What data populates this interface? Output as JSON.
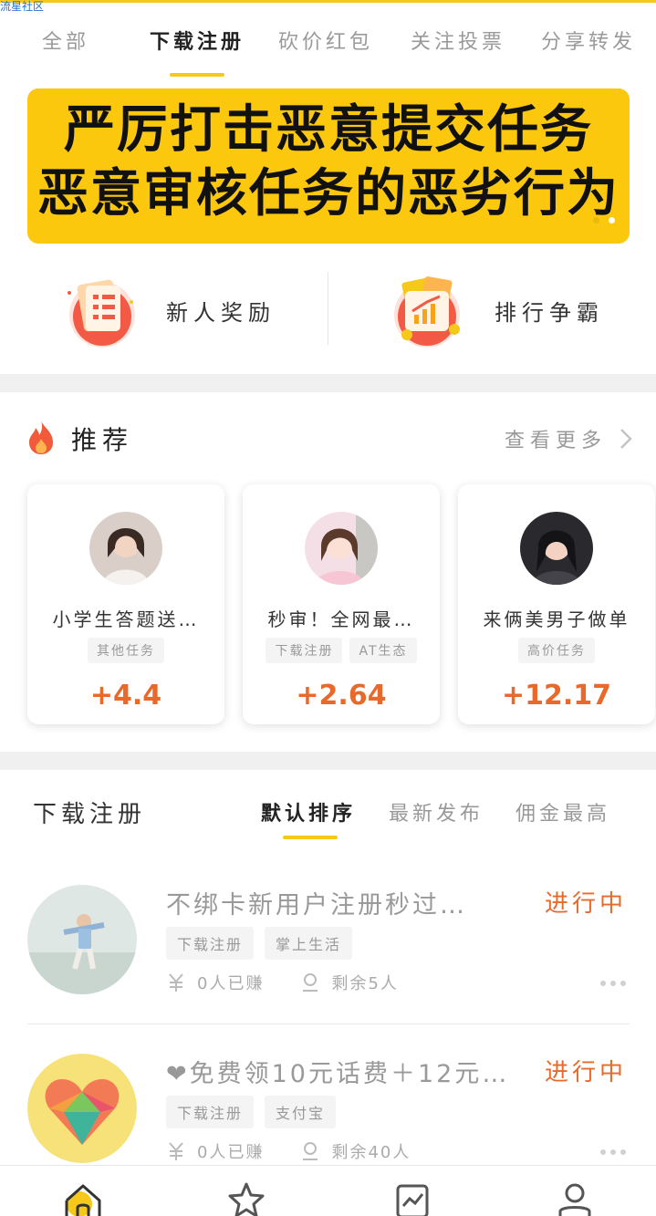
{
  "watermark": "流星社区",
  "tabs": [
    {
      "label": "全部",
      "active": false
    },
    {
      "label": "下载注册",
      "active": true
    },
    {
      "label": "砍价红包",
      "active": false
    },
    {
      "label": "关注投票",
      "active": false
    },
    {
      "label": "分享转发",
      "active": false
    }
  ],
  "banner": {
    "line1": "严厉打击恶意提交任务",
    "line2": "恶意审核任务的恶劣行为",
    "accent": "#fcc80d"
  },
  "quick_entries": [
    {
      "label": "新人奖励",
      "icon": "clipboard-list-icon"
    },
    {
      "label": "排行争霸",
      "icon": "ranking-chart-icon"
    }
  ],
  "recommend": {
    "title": "推荐",
    "more": "查看更多",
    "cards": [
      {
        "title": "小学生答题送…",
        "tags": [
          "其他任务"
        ],
        "amount": "+4.4"
      },
      {
        "title": "秒审！全网最…",
        "tags": [
          "下载注册",
          "AT生态"
        ],
        "amount": "+2.64"
      },
      {
        "title": "来俩美男子做单",
        "tags": [
          "高价任务"
        ],
        "amount": "+12.17"
      }
    ]
  },
  "task_list": {
    "title": "下载注册",
    "sorts": [
      {
        "label": "默认排序",
        "active": true
      },
      {
        "label": "最新发布",
        "active": false
      },
      {
        "label": "佣金最高",
        "active": false
      }
    ],
    "items": [
      {
        "title": "不绑卡新用户注册秒过…",
        "status": "进行中",
        "tags": [
          "下载注册",
          "掌上生活"
        ],
        "earned": "0人已赚",
        "remaining": "剩余5人"
      },
      {
        "title": "❤免费领10元话费＋12元…",
        "status": "进行中",
        "tags": [
          "下载注册",
          "支付宝"
        ],
        "earned": "0人已赚",
        "remaining": "剩余40人"
      }
    ]
  },
  "bottom_nav": [
    {
      "icon": "home-icon",
      "active": true
    },
    {
      "icon": "star-icon",
      "active": false
    },
    {
      "icon": "chart-icon",
      "active": false
    },
    {
      "icon": "user-icon",
      "active": false
    }
  ],
  "colors": {
    "accent": "#f6c81a",
    "amount": "#e8692a"
  }
}
